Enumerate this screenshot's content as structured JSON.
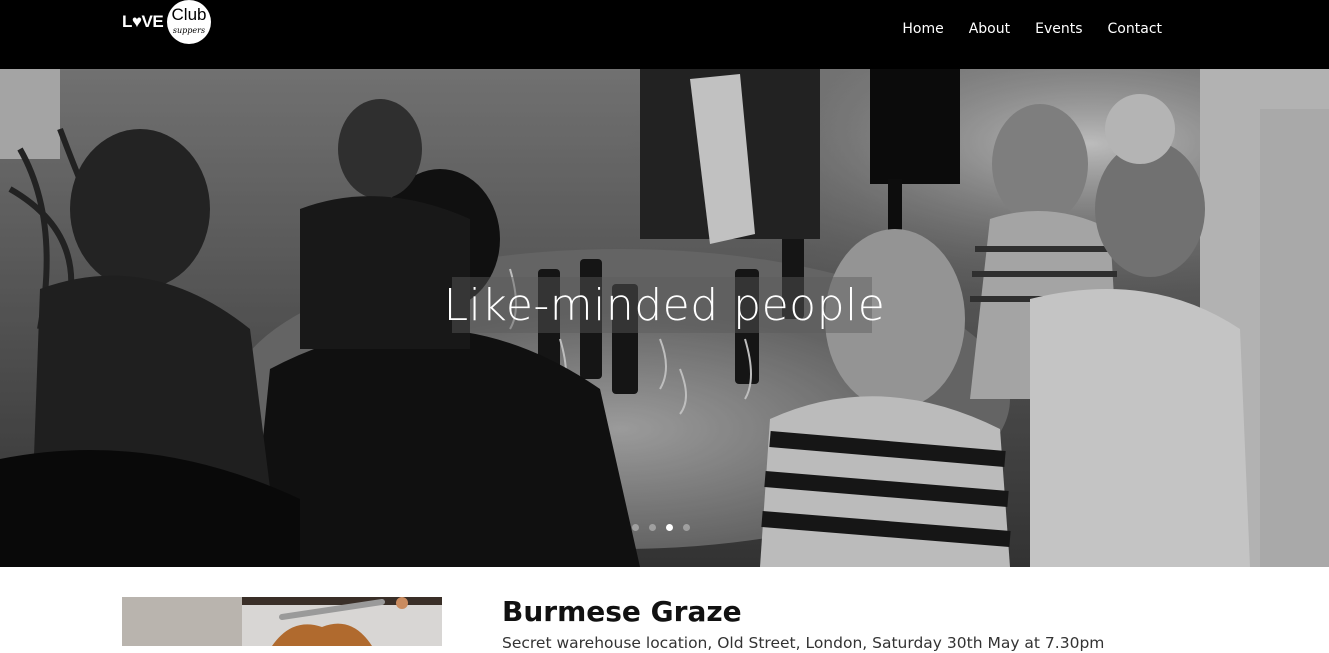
{
  "brand": {
    "logo_word": "L♥VE",
    "logo_circle_word": "Club",
    "logo_script": "suppers"
  },
  "nav": {
    "items": [
      {
        "label": "Home"
      },
      {
        "label": "About"
      },
      {
        "label": "Events"
      },
      {
        "label": "Contact"
      }
    ]
  },
  "hero": {
    "caption": "Like-minded people",
    "slide_count": 4,
    "active_slide": 3
  },
  "event": {
    "title": "Burmese Graze",
    "subtitle": "Secret warehouse location, Old Street, London, Saturday 30th May at 7.30pm"
  },
  "colors": {
    "header_bg": "#000000",
    "nav_text": "#ffffff",
    "hero_caption": "#ffffff",
    "page_bg": "#ffffff"
  }
}
